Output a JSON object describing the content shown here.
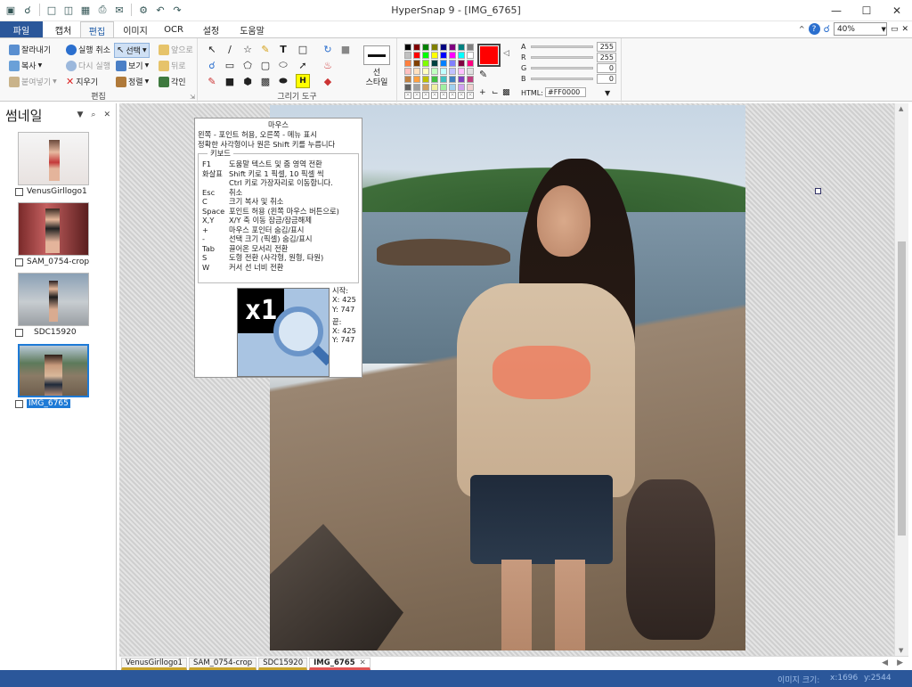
{
  "title": "HyperSnap 9 - [IMG_6765]",
  "colors": {
    "file_tab": "#2b579a",
    "status_bar": "#2b579a",
    "selection": "#1e7ad6",
    "current_color": "#ff0000"
  },
  "quick_access_icons": [
    "app-icon",
    "search-icon",
    "new-icon",
    "open-icon",
    "save-icon",
    "print-icon",
    "send-icon",
    "settings-icon",
    "undo-icon",
    "redo-icon"
  ],
  "tabs": [
    "파일",
    "캡처",
    "편집",
    "이미지",
    "OCR",
    "설정",
    "도움말"
  ],
  "active_tab": "편집",
  "zoom": "40%",
  "ribbon": {
    "edit_group": {
      "label": "편집",
      "cut": "잘라내기",
      "copy": "복사",
      "paste": "붙여넣기",
      "undo": "실행 취소",
      "redo": "다시 실행",
      "delete": "지우기",
      "select": "선택",
      "view": "보기",
      "align": "정렬",
      "front": "앞으로",
      "back": "뒤로",
      "stamp": "각인"
    },
    "drawing_tools_label": "그리기 도구",
    "line_style": "선\n스타일",
    "rgb": {
      "a_label": "A",
      "a": "255",
      "r_label": "R",
      "r": "255",
      "g_label": "G",
      "g": "0",
      "b_label": "B",
      "b": "0",
      "html_label": "HTML:",
      "html": "#FF0000"
    },
    "palette": [
      "#000000",
      "#800000",
      "#008000",
      "#808000",
      "#000080",
      "#800080",
      "#008080",
      "#808080",
      "#c0c0c0",
      "#ff0000",
      "#00ff00",
      "#ffff00",
      "#0000ff",
      "#ff00ff",
      "#00ffff",
      "#ffffff",
      "#ff8040",
      "#804000",
      "#80ff00",
      "#004040",
      "#0080ff",
      "#8080ff",
      "#800040",
      "#ff0080",
      "#ffc0c0",
      "#ffe0c0",
      "#ffffc0",
      "#c0ffc0",
      "#c0ffff",
      "#c0c0ff",
      "#ffc0ff",
      "#e0e0e0",
      "#c08040",
      "#ffa040",
      "#c0c000",
      "#40c040",
      "#40c0c0",
      "#4080c0",
      "#8040c0",
      "#c04080",
      "#606060",
      "#a0a0a0",
      "#d0a060",
      "#f0f0a0",
      "#a0f0a0",
      "#a0d0f0",
      "#d0a0f0",
      "#f0d0d0"
    ]
  },
  "thumbnails": {
    "title": "썸네일",
    "pin": "ㅁ",
    "items": [
      {
        "caption": "VenusGirllogo1"
      },
      {
        "caption": "SAM_0754-crop"
      },
      {
        "caption": "SDC15920"
      },
      {
        "caption": "IMG_6765"
      }
    ]
  },
  "help": {
    "mouse_title": "마우스",
    "mouse_line1": "왼쪽 - 포인트 허용,     오른쪽 - 메뉴 표시",
    "mouse_line2": "정확한 사각형이나 원은 Shift 키를 누릅니다",
    "keyboard_title": "키보드",
    "rows": [
      {
        "k": "F1",
        "v": "도움말 텍스트 및 줌 영역 전환"
      },
      {
        "k": "화살표",
        "v": "Shift 키로 1 픽셀, 10 픽셀 씩"
      },
      {
        "k": "",
        "v": "Ctrl 키로 가장자리로 이동합니다."
      },
      {
        "k": "Esc",
        "v": "취소"
      },
      {
        "k": "C",
        "v": "크기 복사 및 취소"
      },
      {
        "k": "Space",
        "v": "포인트 허용 (왼쪽 마우스 버튼으로)"
      },
      {
        "k": "X,Y",
        "v": "X/Y 축 이동 잠금/잠금해제"
      },
      {
        "k": "+",
        "v": "마우스 포인터 숨김/표시"
      },
      {
        "k": "-",
        "v": "선택 크기 (픽셀) 숨김/표시"
      },
      {
        "k": "Tab",
        "v": "끌어온 모서리 전환"
      },
      {
        "k": "S",
        "v": "도형 전환 (사각형, 원형, 타원)"
      },
      {
        "k": "W",
        "v": "커서 선 너비 전환"
      }
    ],
    "zoom_label": "x1",
    "start_label": "시작:",
    "start_x": "X: 425",
    "start_y": "Y: 747",
    "end_label": "끝:",
    "end_x": "X: 425",
    "end_y": "Y: 747"
  },
  "doc_tabs": [
    "VenusGirllogo1",
    "SAM_0754-crop",
    "SDC15920",
    "IMG_6765"
  ],
  "status": {
    "image_size": "이미지 크기:",
    "x": "x:1696",
    "y": "y:2544"
  }
}
